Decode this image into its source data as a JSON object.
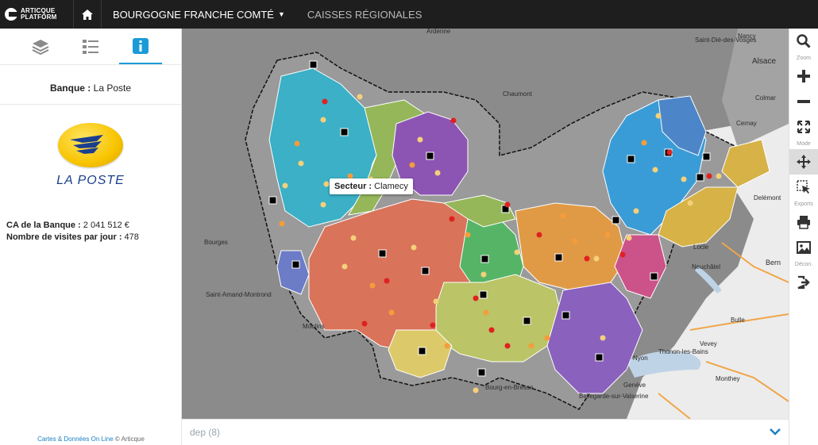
{
  "app": {
    "logo_line1": "ARTICQUE",
    "logo_line2": "PLATFORM",
    "nav_region": "BOURGOGNE FRANCHE COMTÉ",
    "nav_caisses": "CAISSES RÉGIONALES"
  },
  "left": {
    "bank_label": "Banque :",
    "bank_value": "La Poste",
    "logo_text": "LA POSTE",
    "ca_label": "CA de la Banque :",
    "ca_value": "2 041 512 €",
    "visits_label": "Nombre de visites par jour :",
    "visits_value": "478",
    "credits_link": "Cartes & Données On Line",
    "credits_rest": "© Articque"
  },
  "tooltip": {
    "label": "Secteur :",
    "value": "Clamecy"
  },
  "bottom": {
    "layer": "dep (8)"
  },
  "tools": {
    "zoom_label": "Zoom",
    "mode_label": "Mode",
    "exports_label": "Exports",
    "decon_label": "Décon."
  },
  "map_labels": {
    "ardenne": "Ardenne",
    "chaumont": "Chaumont",
    "alsace": "Alsace",
    "nancy": "Nancy",
    "saint_die": "Saint-Dié-des-Vosges",
    "colmar": "Colmar",
    "cernay": "Cernay",
    "bourges": "Bourges",
    "saint_amand": "Saint-Amand-Montrond",
    "moulins": "Moulins",
    "delemont": "Delémont",
    "bern": "Bern",
    "neuchatel": "Neuchâtel",
    "bulle": "Bulle",
    "thonon": "Thonon-les-Bains",
    "vevey": "Vevey",
    "montbey": "Monthey",
    "nyon": "Nyon",
    "geneve": "Genève",
    "bourg": "Bourg-en-Bresse",
    "bellegarde": "Bellegarde-sur-Valserine",
    "locle": "Locle"
  },
  "colors": {
    "accent": "#1a9bd7",
    "topbar": "#1e1e1e"
  }
}
